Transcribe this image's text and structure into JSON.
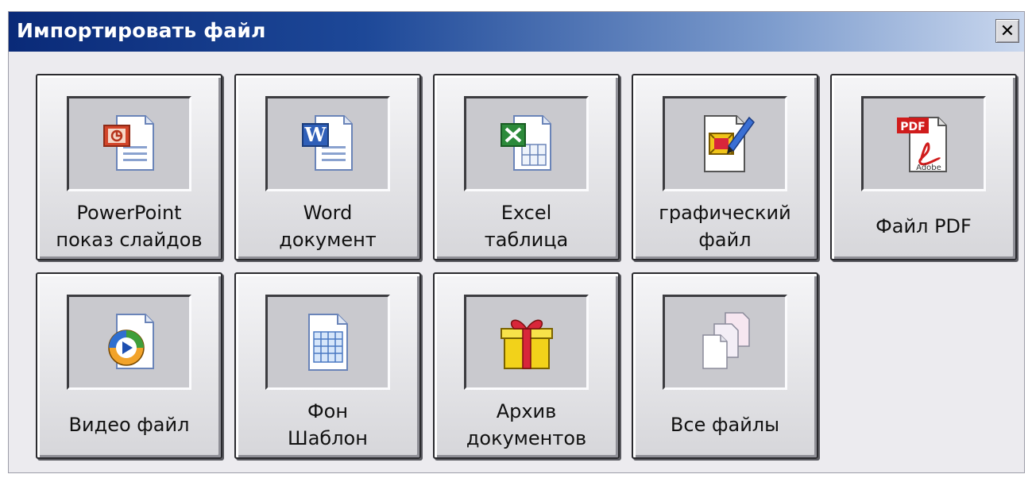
{
  "window": {
    "title": "Импортировать файл",
    "close_symbol": "✕"
  },
  "tiles": [
    {
      "label1": "PowerPoint",
      "label2": "показ слайдов",
      "icon": "powerpoint-file-icon"
    },
    {
      "label1": "Word",
      "label2": "документ",
      "icon": "word-file-icon"
    },
    {
      "label1": "Excel",
      "label2": "таблица",
      "icon": "excel-file-icon"
    },
    {
      "label1": "графический",
      "label2": "файл",
      "icon": "picture-file-icon"
    },
    {
      "label1": "Файл PDF",
      "label2": "",
      "icon": "pdf-file-icon"
    },
    {
      "label1": "Видео файл",
      "label2": "",
      "icon": "video-file-icon"
    },
    {
      "label1": "Фон",
      "label2": "Шаблон",
      "icon": "template-file-icon"
    },
    {
      "label1": "Архив",
      "label2": "документов",
      "icon": "gift-archive-icon"
    },
    {
      "label1": "Все файлы",
      "label2": "",
      "icon": "all-files-icon"
    }
  ],
  "icon_texts": {
    "pdf_badge": "PDF",
    "adobe": "Adobe",
    "word_letter": "W"
  },
  "colors": {
    "title_gradient_start": "#0a2a78",
    "title_gradient_end": "#c9d7ee",
    "dialog_bg": "#ecebef",
    "powerpoint": "#d2452a",
    "word": "#2f5fb8",
    "excel": "#2c8a3a",
    "pdf_red": "#d01c1c"
  }
}
